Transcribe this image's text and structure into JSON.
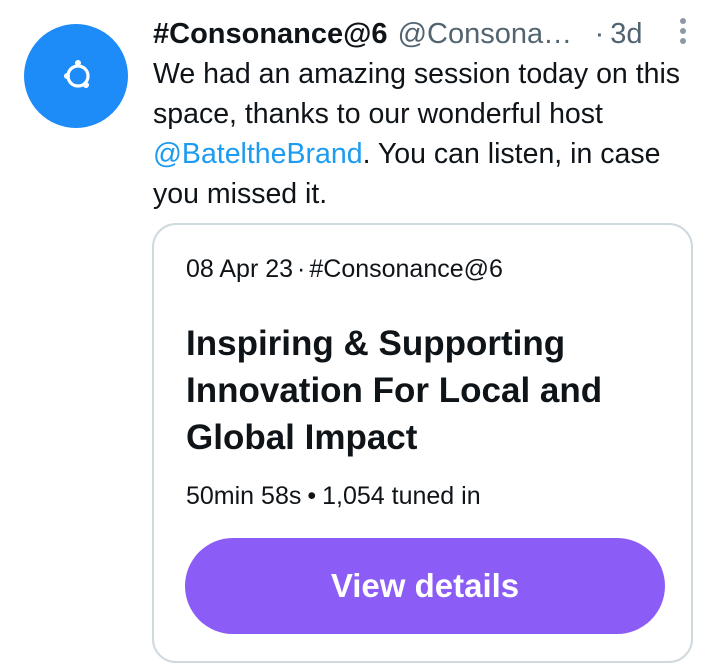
{
  "author": {
    "display_name": "#Consonance@6",
    "handle": "@Consonan...",
    "separator": "·",
    "time": "3d",
    "avatar_color": "#1d8cf8"
  },
  "tweet": {
    "text_before": "We had an amazing session today on this space, thanks to our wonderful host ",
    "mention": "@BateltheBrand",
    "text_after": ". You can listen, in case you missed it."
  },
  "space_card": {
    "date": "08 Apr 23",
    "separator": "·",
    "host": "#Consonance@6",
    "title": "Inspiring & Supporting Innovation For Local and Global Impact",
    "duration": "50min 58s",
    "bullet": "•",
    "tuned_in": "1,054 tuned in",
    "button_label": "View details",
    "button_color": "#8b5cf6"
  },
  "icons": {
    "more": "more-vertical-icon",
    "avatar_logo": "orbit-logo-icon"
  }
}
